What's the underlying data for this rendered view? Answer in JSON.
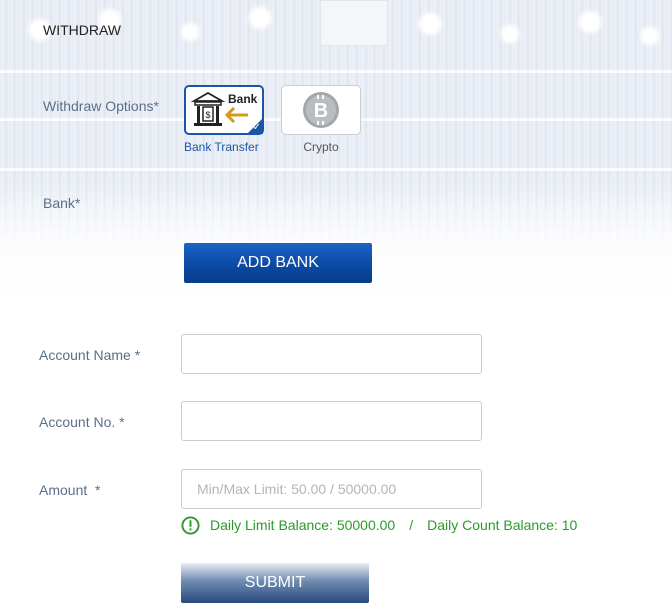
{
  "header": {
    "title": "WITHDRAW"
  },
  "withdraw_options": {
    "label": "Withdraw Options*",
    "options": [
      {
        "icon": "bank-transfer-icon",
        "icon_text": "Bank",
        "caption": "Bank Transfer",
        "selected": true
      },
      {
        "icon": "bitcoin-icon",
        "caption": "Crypto",
        "selected": false
      }
    ]
  },
  "bank": {
    "label": "Bank*",
    "add_button": "ADD BANK"
  },
  "form": {
    "account_name": {
      "label": "Account Name *",
      "value": "",
      "placeholder": ""
    },
    "account_no": {
      "label": "Account No. *",
      "value": "",
      "placeholder": ""
    },
    "amount": {
      "label": "Amount  *",
      "value": "",
      "placeholder": "Min/Max Limit: 50.00 / 50000.00"
    }
  },
  "limits": {
    "daily_limit": "Daily Limit Balance: 50000.00",
    "separator": "/",
    "daily_count": "Daily Count Balance: 10",
    "color": "#2b9a2b"
  },
  "submit_button": "SUBMIT",
  "colors": {
    "accent": "#1a56a8",
    "label": "#5b6f8a"
  }
}
